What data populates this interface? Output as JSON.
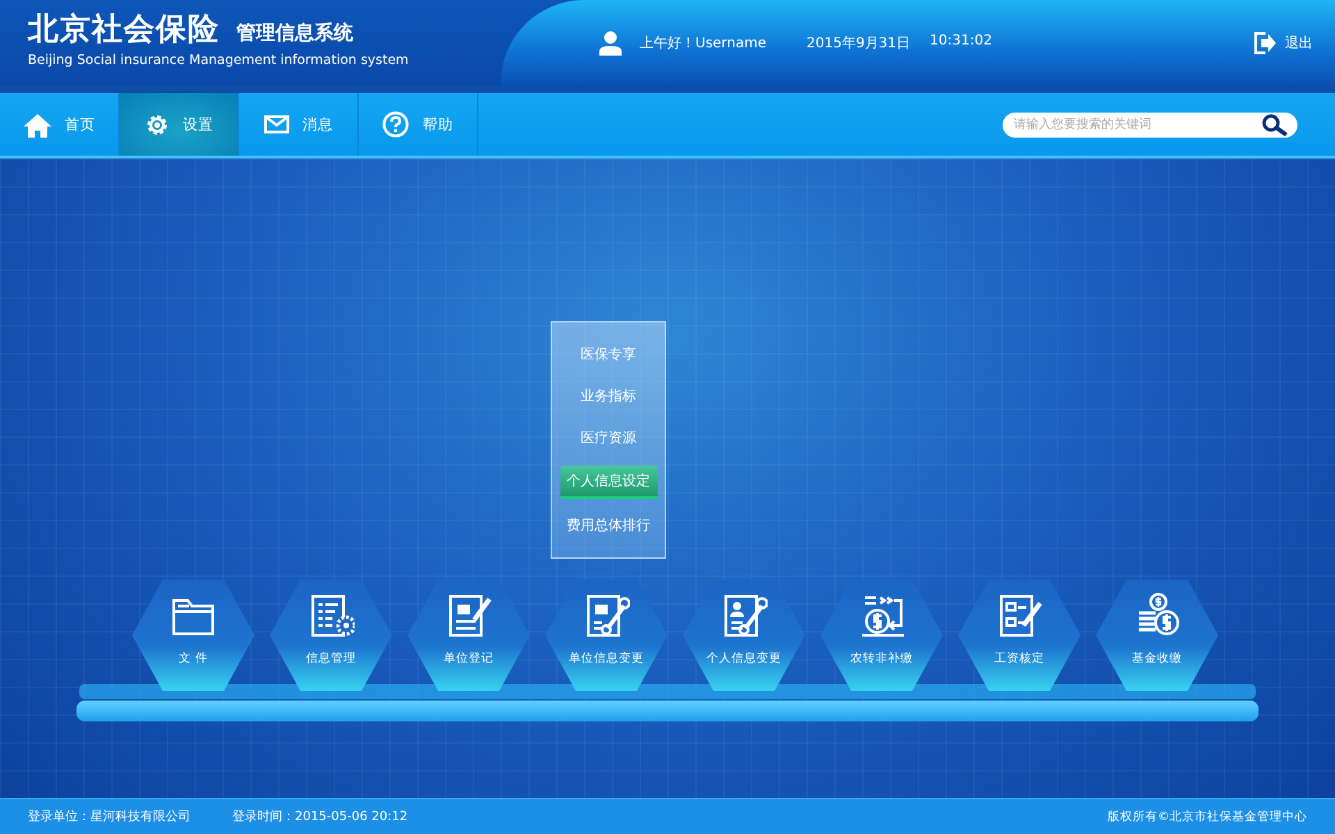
{
  "header": {
    "title": "北京社会保险",
    "subtitle": "管理信息系统",
    "english": "Beijing Social insurance  Management information system",
    "greeting": "上午好！Username",
    "date": "2015年9月31日",
    "time": "10:31:02",
    "logout": "退出"
  },
  "nav": {
    "items": [
      {
        "label": "首页",
        "selected": false
      },
      {
        "label": "设置",
        "selected": true
      },
      {
        "label": "消息",
        "selected": false
      },
      {
        "label": "帮助",
        "selected": false
      }
    ],
    "search": {
      "placeholder": "请输入您要搜索的关键词"
    }
  },
  "menu": {
    "items": [
      {
        "label": "医保专享",
        "selected": false
      },
      {
        "label": "业务指标",
        "selected": false
      },
      {
        "label": "医疗资源",
        "selected": false
      },
      {
        "label": "个人信息设定",
        "selected": true
      },
      {
        "label": "费用总体排行",
        "selected": false
      }
    ]
  },
  "tiles": [
    {
      "label": "文 件"
    },
    {
      "label": "信息管理"
    },
    {
      "label": "单位登记"
    },
    {
      "label": "单位信息变更"
    },
    {
      "label": "个人信息变更"
    },
    {
      "label": "农转非补缴"
    },
    {
      "label": "工资核定"
    },
    {
      "label": "基金收缴"
    }
  ],
  "footer": {
    "unit": "登录单位：星河科技有限公司",
    "login_time": "登录时间：2015-05-06  20:12",
    "copyright": "版权所有©北京市社保基金管理中心"
  }
}
